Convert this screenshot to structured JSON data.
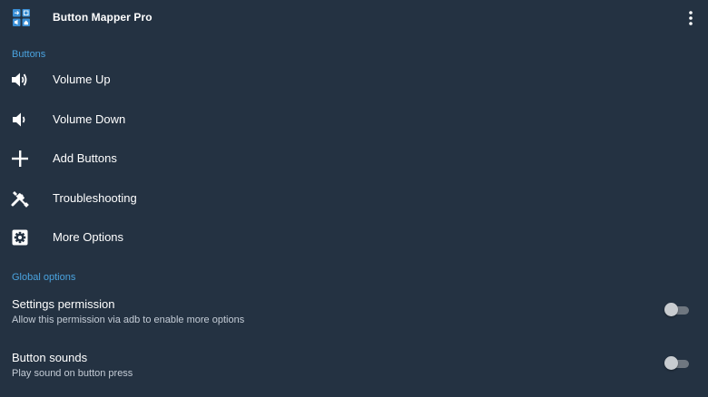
{
  "app": {
    "title": "Button Mapper Pro",
    "icon": "app-logo-icon",
    "overflow_icon": "more-vert-icon"
  },
  "sections": {
    "buttons_header": "Buttons",
    "global_header": "Global options"
  },
  "menu": [
    {
      "label": "Volume Up",
      "icon": "volume-up-icon"
    },
    {
      "label": "Volume Down",
      "icon": "volume-down-icon"
    },
    {
      "label": "Add Buttons",
      "icon": "plus-icon"
    },
    {
      "label": "Troubleshooting",
      "icon": "tools-icon"
    },
    {
      "label": "More Options",
      "icon": "settings-gear-icon"
    }
  ],
  "global_options": [
    {
      "title": "Settings permission",
      "summary": "Allow this permission via adb to enable more options",
      "enabled": false
    },
    {
      "title": "Button sounds",
      "summary": "Play sound on button press",
      "enabled": false
    }
  ],
  "colors": {
    "background": "#243242",
    "accent": "#4aa3df",
    "text": "#ffffff",
    "secondary_text": "#c4ccd6"
  }
}
